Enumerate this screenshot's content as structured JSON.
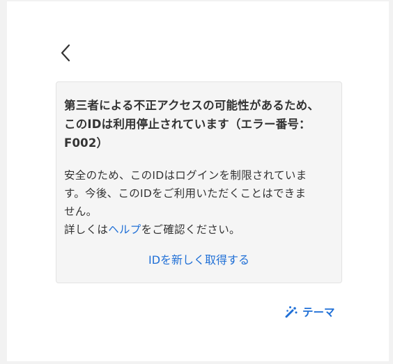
{
  "back": {
    "icon": "chevron-left-icon"
  },
  "error_card": {
    "title_line1": "第三者による不正アクセスの可能性があるため、",
    "title_line2": "このIDは利用停止されています（エラー番号：",
    "title_line3": "F002）",
    "body_line1": "安全のため、このIDはログインを制限されていま",
    "body_line2": "す。今後、このIDをご利用いただくことはできま",
    "body_line3": "せん。",
    "body_line4_before": "詳しくは",
    "help_link": "ヘルプ",
    "body_line4_after": "をご確認ください。",
    "reacquire_link": "IDを新しく取得する"
  },
  "theme": {
    "label": "テーマ",
    "icon": "magic-wand-icon"
  },
  "colors": {
    "link": "#1f6fd6",
    "text": "#333333",
    "card_bg": "#f5f5f5",
    "page_bg": "#f2f2f2"
  }
}
